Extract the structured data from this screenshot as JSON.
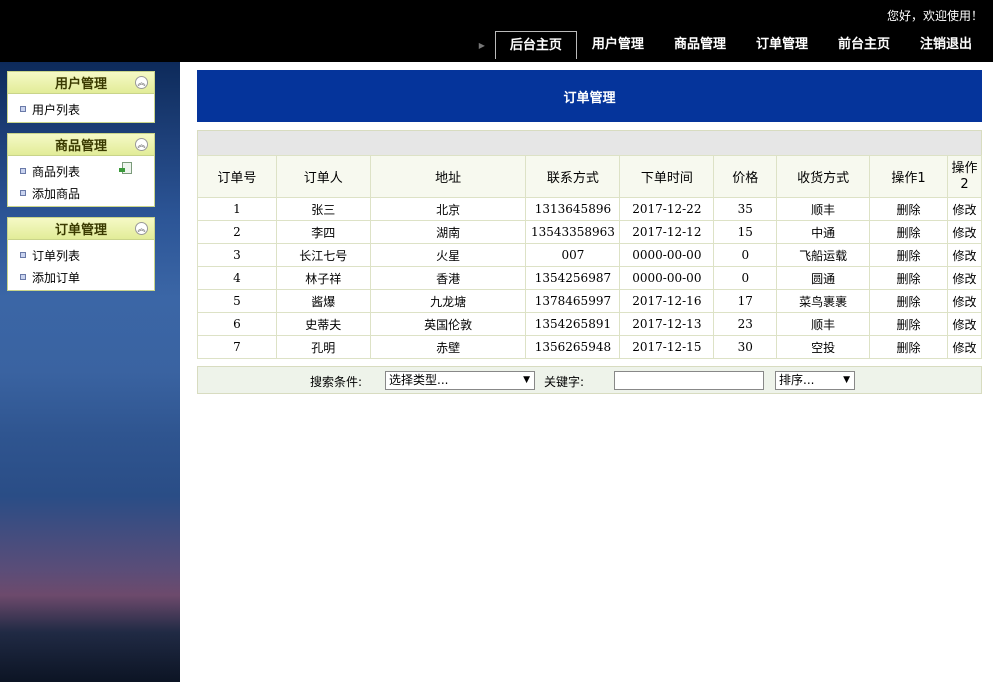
{
  "header": {
    "welcome": "您好，欢迎使用！",
    "nav": [
      "后台主页",
      "用户管理",
      "商品管理",
      "订单管理",
      "前台主页",
      "注销退出"
    ]
  },
  "sidebar": {
    "panels": [
      {
        "title": "用户管理",
        "items": [
          "用户列表"
        ]
      },
      {
        "title": "商品管理",
        "items": [
          "商品列表",
          "添加商品"
        ]
      },
      {
        "title": "订单管理",
        "items": [
          "订单列表",
          "添加订单"
        ]
      }
    ]
  },
  "main": {
    "title": "订单管理",
    "table": {
      "headers": [
        "订单号",
        "订单人",
        "地址",
        "联系方式",
        "下单时间",
        "价格",
        "收货方式",
        "操作1",
        "操作2"
      ],
      "rows": [
        [
          "1",
          "张三",
          "北京",
          "1313645896",
          "2017-12-22",
          "35",
          "顺丰",
          "删除",
          "修改"
        ],
        [
          "2",
          "李四",
          "湖南",
          "13543358963",
          "2017-12-12",
          "15",
          "中通",
          "删除",
          "修改"
        ],
        [
          "3",
          "长江七号",
          "火星",
          "007",
          "0000-00-00",
          "0",
          "飞船运载",
          "删除",
          "修改"
        ],
        [
          "4",
          "林子祥",
          "香港",
          "1354256987",
          "0000-00-00",
          "0",
          "圆通",
          "删除",
          "修改"
        ],
        [
          "5",
          "酱爆",
          "九龙塘",
          "1378465997",
          "2017-12-16",
          "17",
          "菜鸟裹裹",
          "删除",
          "修改"
        ],
        [
          "6",
          "史蒂夫",
          "英国伦敦",
          "1354265891",
          "2017-12-13",
          "23",
          "顺丰",
          "删除",
          "修改"
        ],
        [
          "7",
          "孔明",
          "赤壁",
          "1356265948",
          "2017-12-15",
          "30",
          "空投",
          "删除",
          "修改"
        ]
      ]
    },
    "search": {
      "condition_label": "搜索条件:",
      "type_select": "选择类型...",
      "keyword_label": "关键字:",
      "keyword_value": "",
      "sort_select": "排序..."
    }
  },
  "colors": {
    "header_bg": "#000000",
    "title_bar": "#05349b",
    "panel_head": "#e2ec98"
  }
}
